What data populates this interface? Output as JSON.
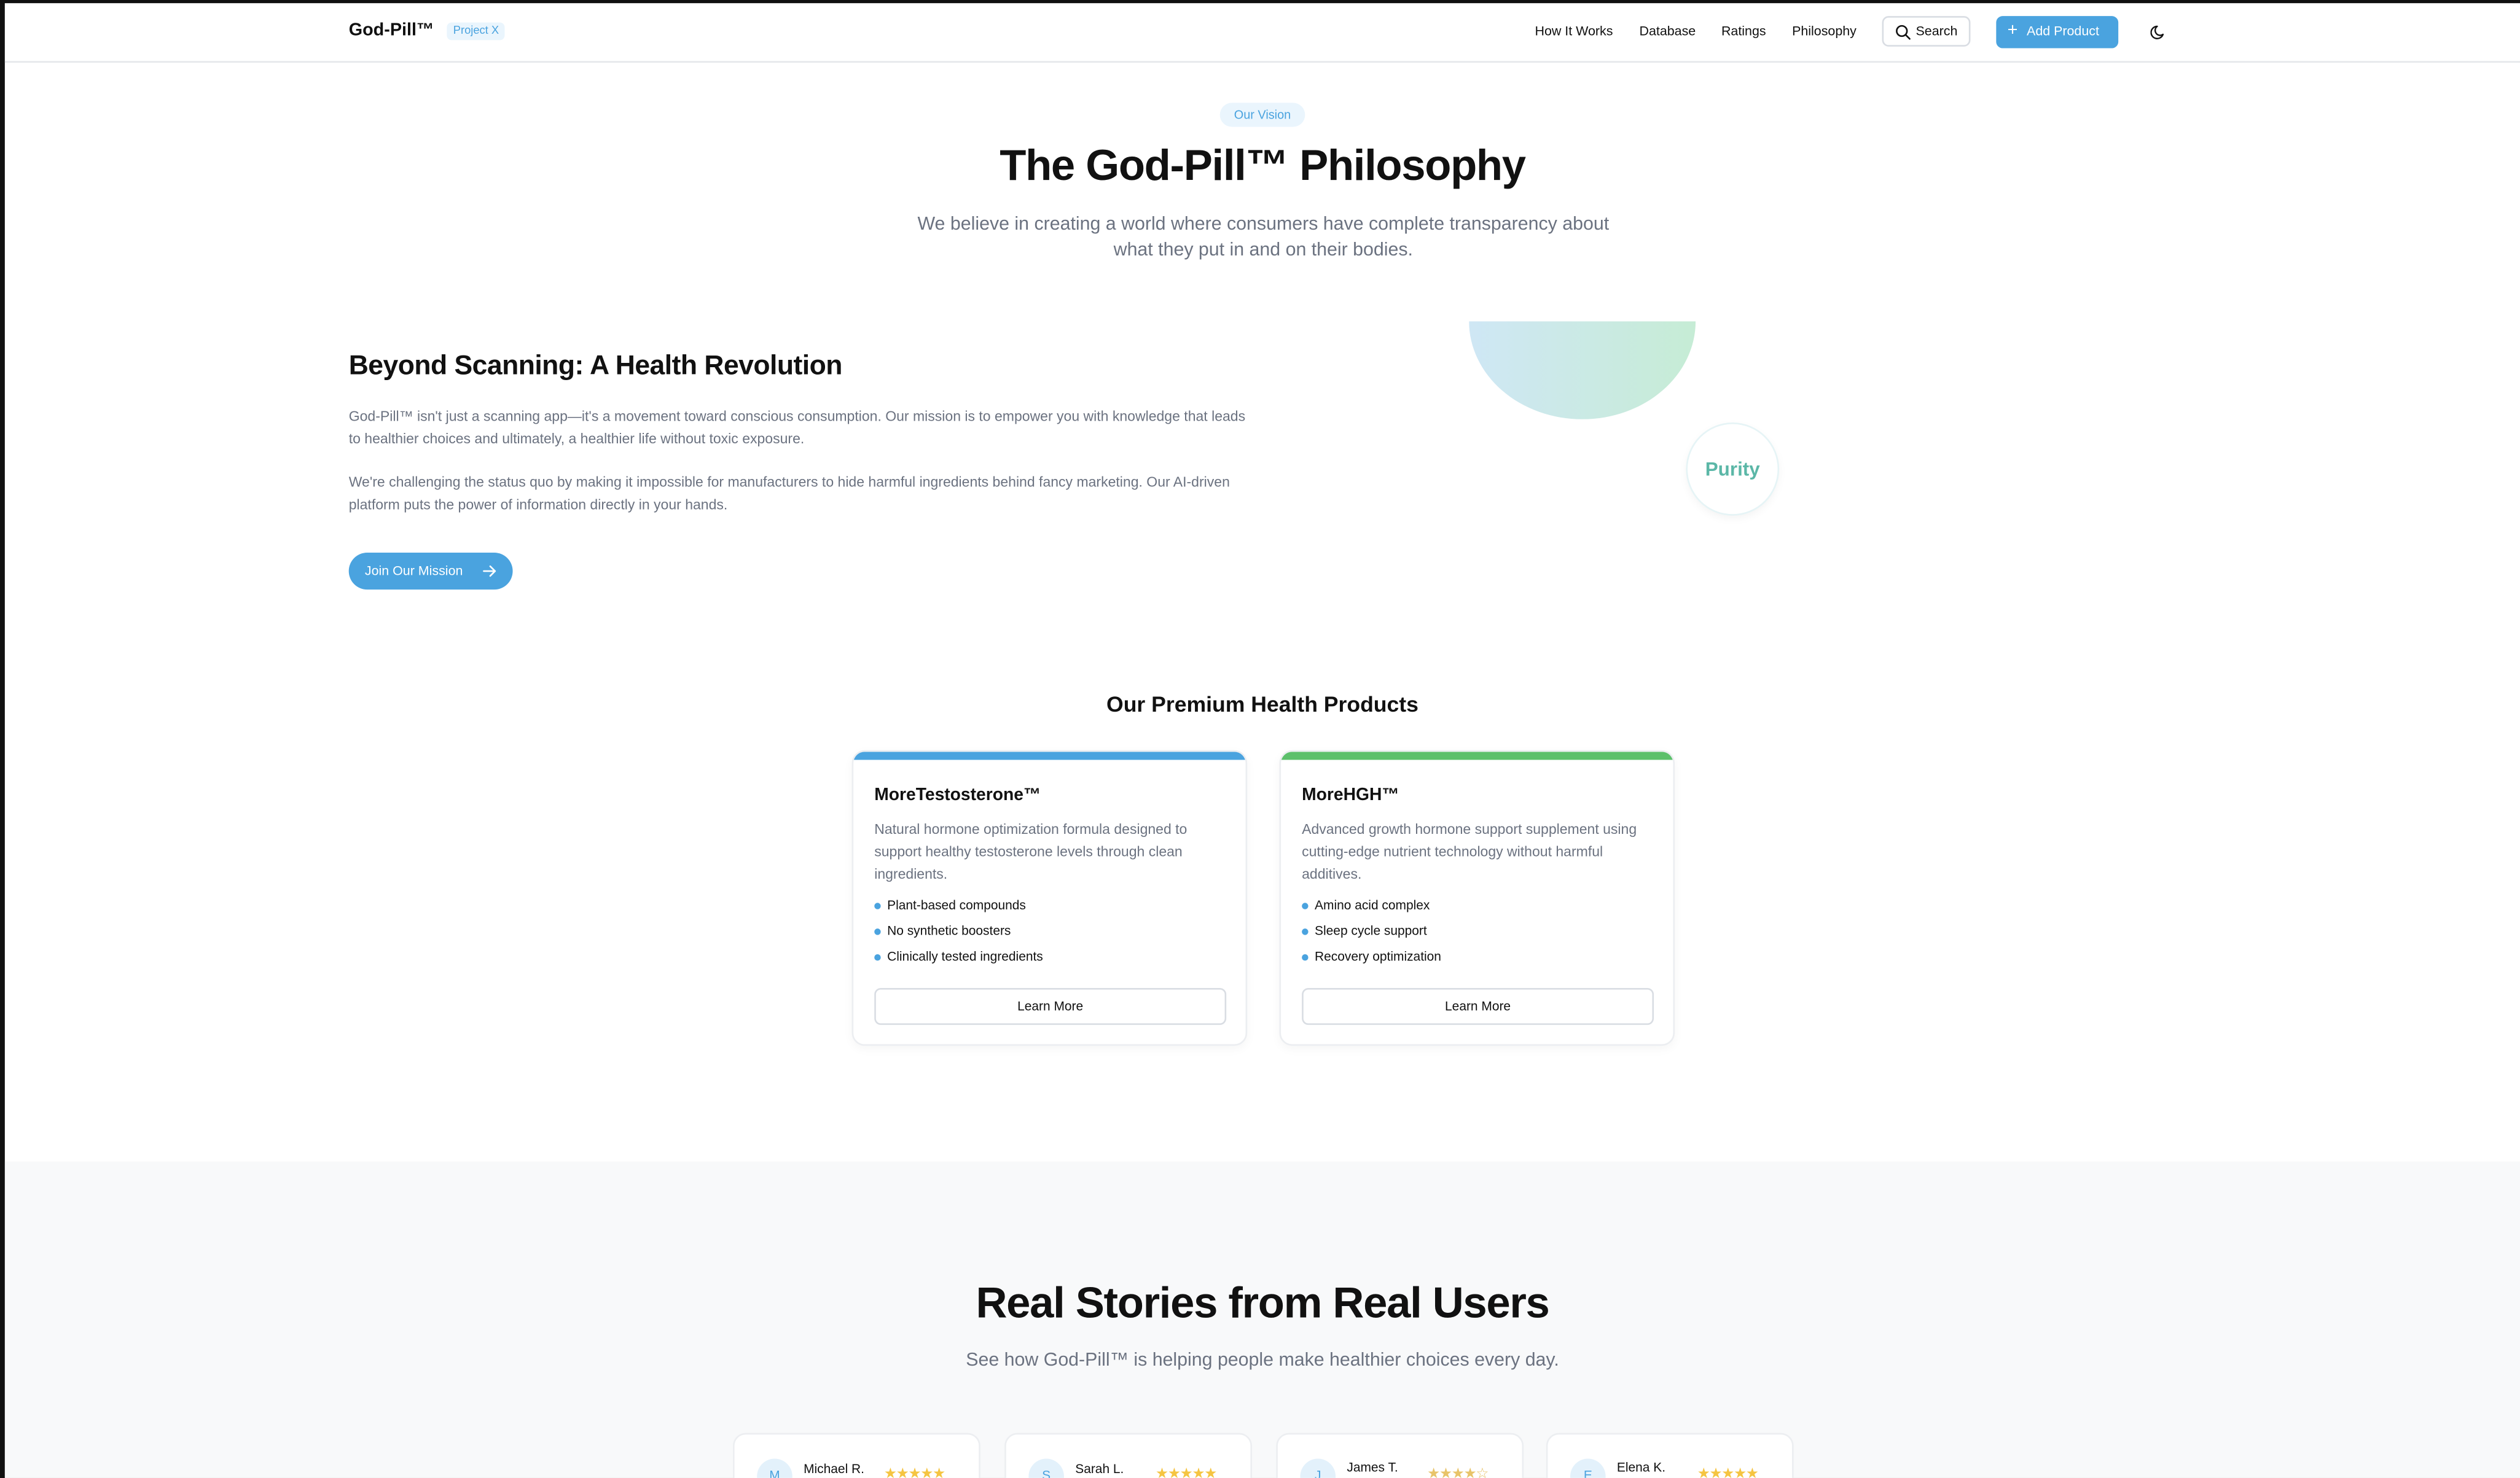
{
  "header": {
    "brand": "God-Pill™",
    "badge": "Project X",
    "nav": [
      "How It Works",
      "Database",
      "Ratings",
      "Philosophy"
    ],
    "search_label": "Search",
    "add_product_label": "Add Product"
  },
  "hero": {
    "tag": "Our Vision",
    "title": "The God-Pill™ Philosophy",
    "subtitle": "We believe in creating a world where consumers have complete transparency about what they put in and on their bodies."
  },
  "mission": {
    "title": "Beyond Scanning: A Health Revolution",
    "paragraph1": "God-Pill™ isn't just a scanning app—it's a movement toward conscious consumption. Our mission is to empower you with knowledge that leads to healthier choices and ultimately, a healthier life without toxic exposure.",
    "paragraph2": "We're challenging the status quo by making it impossible for manufacturers to hide harmful ingredients behind fancy marketing. Our AI-driven platform puts the power of information directly in your hands.",
    "cta_label": "Join Our Mission",
    "purity_label": "Purity"
  },
  "products": {
    "title": "Our Premium Health Products",
    "items": [
      {
        "name": "MoreTestosterone™",
        "description": "Natural hormone optimization formula designed to support healthy testosterone levels through clean ingredients.",
        "features": [
          "Plant-based compounds",
          "No synthetic boosters",
          "Clinically tested ingredients"
        ],
        "cta": "Learn More",
        "accent": "#4aa3df"
      },
      {
        "name": "MoreHGH™",
        "description": "Advanced growth hormone support supplement using cutting-edge nutrient technology without harmful additives.",
        "features": [
          "Amino acid complex",
          "Sleep cycle support",
          "Recovery optimization"
        ],
        "cta": "Learn More",
        "accent": "#5cc06b"
      }
    ]
  },
  "stories": {
    "title": "Real Stories from Real Users",
    "subtitle": "See how God-Pill™ is helping people make healthier choices every day.",
    "users": [
      {
        "initial": "M",
        "name": "Michael R.",
        "stars": "★★★★★"
      },
      {
        "initial": "S",
        "name": "Sarah L.",
        "stars": "★★★★★"
      },
      {
        "initial": "J",
        "name": "James T.",
        "stars": "★★★★☆"
      },
      {
        "initial": "E",
        "name": "Elena K.",
        "stars": "★★★★★"
      }
    ]
  },
  "colors": {
    "accent": "#4aa3df",
    "green": "#5cc06b",
    "purity": "#5bb7a7"
  },
  "icons": [
    "search-icon",
    "plus-icon",
    "moon-icon",
    "arrow-right-icon",
    "bullet-dot-icon",
    "star-icon"
  ]
}
